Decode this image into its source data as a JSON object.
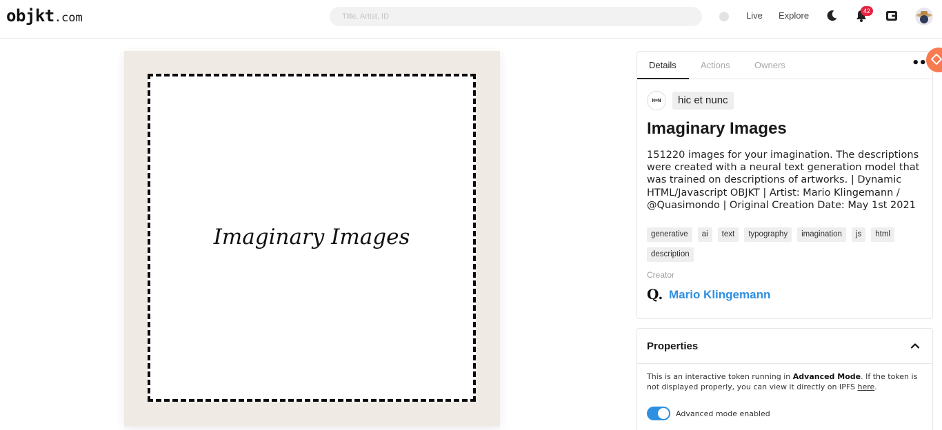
{
  "header": {
    "logo_main": "objkt",
    "logo_tld": ".com",
    "search_placeholder": "Title, Artist, ID",
    "nav": {
      "live": "Live",
      "explore": "Explore"
    },
    "notification_count": "42",
    "icons": [
      "moon-icon",
      "bell-icon",
      "wallet-icon",
      "avatar"
    ]
  },
  "artwork": {
    "preview_text": "Imaginary Images"
  },
  "details": {
    "tabs": [
      {
        "label": "Details",
        "active": true
      },
      {
        "label": "Actions",
        "active": false
      },
      {
        "label": "Owners",
        "active": false
      }
    ],
    "more_label": "•••",
    "platform_logo_text": "H=N",
    "platform": "hic et nunc",
    "title": "Imaginary Images",
    "description": "151220 images for your imagination. The descriptions were created with a neural text generation model that was trained on descriptions of artworks. | Dynamic HTML/Javascript OBJKT | Artist: Mario Klingemann / @Quasimondo | Original Creation Date: May 1st 2021",
    "tags": [
      "generative",
      "ai",
      "text",
      "typography",
      "imagination",
      "js",
      "html",
      "description"
    ],
    "creator_label": "Creator",
    "creator_avatar_text": "Q.",
    "creator_name": "Mario Klingemann"
  },
  "properties": {
    "title": "Properties",
    "text_before": "This is an interactive token running in ",
    "text_bold": "Advanced Mode",
    "text_middle": ". If the token is not displayed properly, you can view it directly on IPFS ",
    "link_label": "here",
    "text_after": ".",
    "toggle_label": "Advanced mode enabled",
    "toggle_enabled": true
  },
  "colors": {
    "accent": "#2f8fe0",
    "badge": "#e5223f",
    "art_background": "#efebe4",
    "fab": "#f77b4f"
  }
}
